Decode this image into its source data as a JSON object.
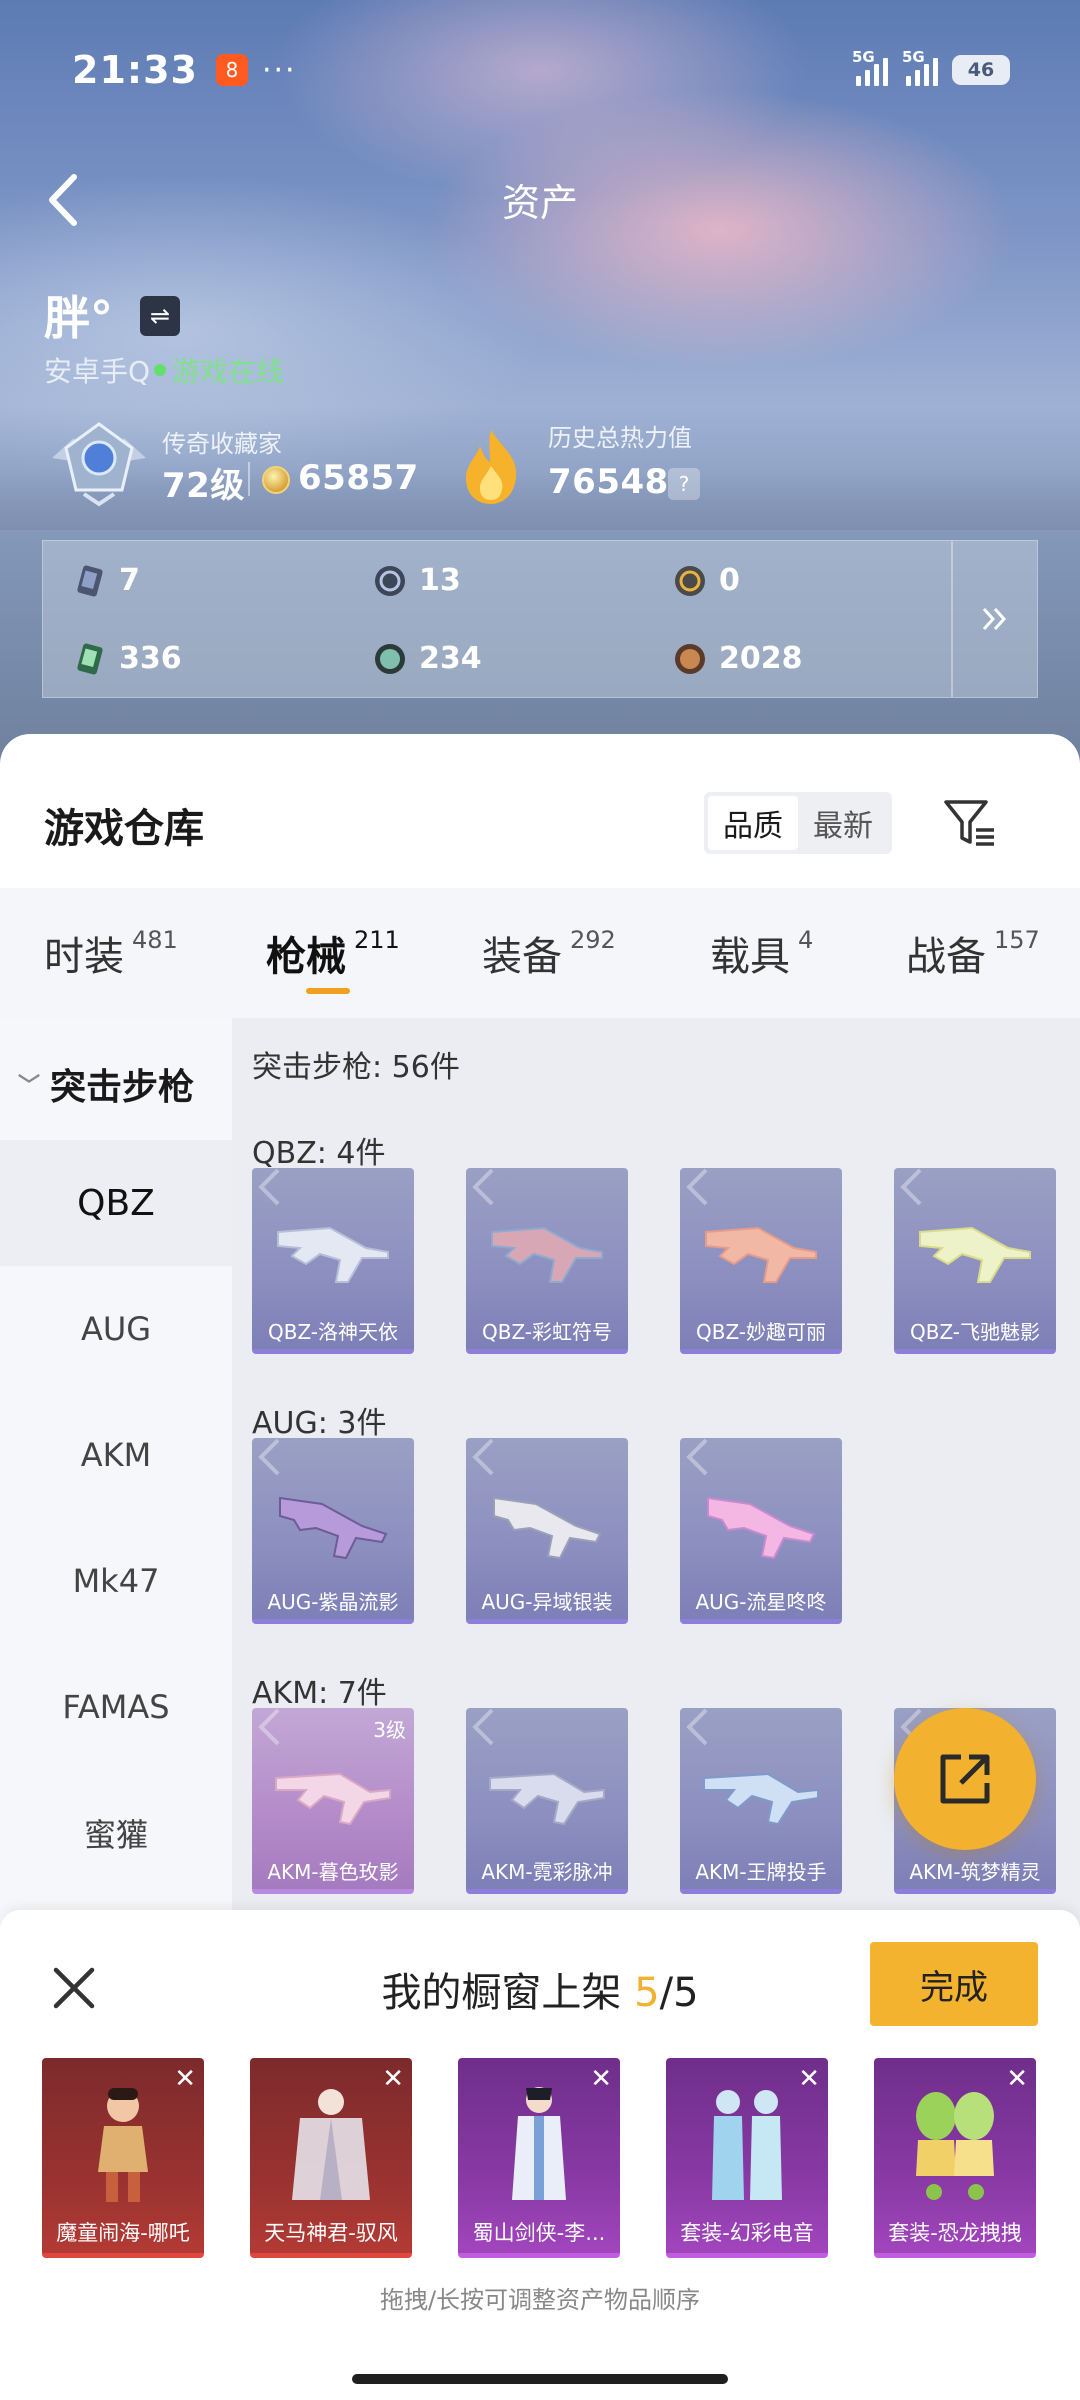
{
  "status": {
    "time": "21:33",
    "app_badge": "8",
    "dots": "···",
    "net1": "5G",
    "net2": "5G",
    "battery": "46"
  },
  "nav": {
    "title": "资产"
  },
  "profile": {
    "name": "胖°",
    "platform": "安卓手Q",
    "online": "游戏在线",
    "rank_label": "传奇收藏家",
    "level": "72级",
    "coins": "65857",
    "heat_label": "历史总热力值",
    "heat_value": "76548",
    "help": "?"
  },
  "currencies": [
    {
      "value": "7",
      "icon": "card-icon"
    },
    {
      "value": "13",
      "icon": "token-icon"
    },
    {
      "value": "0",
      "icon": "gold-token-icon"
    },
    {
      "value": "336",
      "icon": "green-card-icon"
    },
    {
      "value": "234",
      "icon": "orb-icon"
    },
    {
      "value": "2028",
      "icon": "bronze-coin-icon"
    }
  ],
  "warehouse": {
    "title": "游戏仓库",
    "sort_options": [
      "品质",
      "最新"
    ],
    "sort_selected": "品质"
  },
  "tabs": [
    {
      "label": "时装",
      "count": "481"
    },
    {
      "label": "枪械",
      "count": "211"
    },
    {
      "label": "装备",
      "count": "292"
    },
    {
      "label": "载具",
      "count": "4"
    },
    {
      "label": "战备",
      "count": "157"
    }
  ],
  "active_tab": "枪械",
  "categories": {
    "head": "突击步枪",
    "items": [
      "QBZ",
      "AUG",
      "AKM",
      "Mk47",
      "FAMAS",
      "蜜獾"
    ],
    "active": "QBZ"
  },
  "grid": {
    "header": "突击步枪: 56件",
    "groups": [
      {
        "title": "QBZ: 4件",
        "items": [
          "QBZ-洛神天依",
          "QBZ-彩虹符号",
          "QBZ-妙趣可丽",
          "QBZ-飞驰魅影"
        ]
      },
      {
        "title": "AUG: 3件",
        "items": [
          "AUG-紫晶流影",
          "AUG-异域银装",
          "AUG-流星咚咚"
        ]
      },
      {
        "title": "AKM: 7件",
        "items": [
          "AKM-暮色玫影",
          "AKM-霓彩脉冲",
          "AKM-王牌投手",
          "AKM-筑梦精灵"
        ],
        "first_level": "3级"
      }
    ]
  },
  "showcase": {
    "title_prefix": "我的橱窗上架",
    "current": "5",
    "total": "/5",
    "done_label": "完成",
    "items": [
      {
        "name": "魔童闹海-哪吒",
        "color": "#b33a35"
      },
      {
        "name": "天马神君-驭风",
        "color": "#b33a35"
      },
      {
        "name": "蜀山剑侠-李...",
        "color": "#a245bd"
      },
      {
        "name": "套装-幻彩电音",
        "color": "#a245bd"
      },
      {
        "name": "套装-恐龙拽拽",
        "color": "#a245bd"
      }
    ],
    "hint": "拖拽/长按可调整资产物品顺序"
  }
}
